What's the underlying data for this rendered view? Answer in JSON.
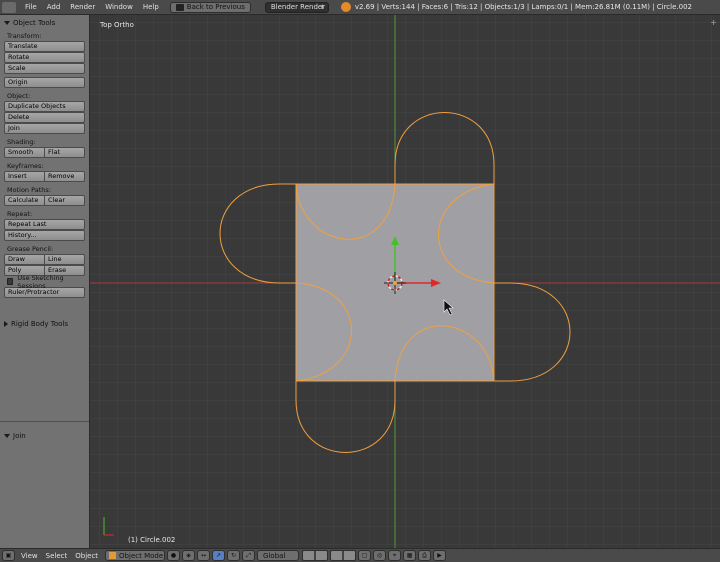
{
  "topbar": {
    "menu": [
      "File",
      "Add",
      "Render",
      "Window",
      "Help"
    ],
    "back_button": "Back to Previous",
    "render_engine": "Blender Render",
    "stats": "v2.69 | Verts:144 | Faces:6 | Tris:12 | Objects:1/3 | Lamps:0/1 | Mem:26.81M (0.11M) | Circle.002"
  },
  "toolshelf": {
    "title": "Object Tools",
    "transform_label": "Transform:",
    "translate": "Translate",
    "rotate": "Rotate",
    "scale": "Scale",
    "origin": "Origin",
    "object_label": "Object:",
    "duplicate": "Duplicate Objects",
    "delete": "Delete",
    "join": "Join",
    "shading_label": "Shading:",
    "smooth": "Smooth",
    "flat": "Flat",
    "keyframes_label": "Keyframes:",
    "insert": "Insert",
    "remove": "Remove",
    "motion_label": "Motion Paths:",
    "calculate": "Calculate",
    "clear": "Clear",
    "repeat_label": "Repeat:",
    "repeat_last": "Repeat Last",
    "history": "History...",
    "grease_label": "Grease Pencil:",
    "draw": "Draw",
    "line": "Line",
    "poly": "Poly",
    "erase": "Erase",
    "sketching": "Use Sketching Sessions",
    "ruler": "Ruler/Protractor",
    "rigid": "Rigid Body Tools",
    "redo_panel": "Join"
  },
  "viewport": {
    "view_name": "Top Ortho",
    "object_info": "(1) Circle.002",
    "colors": {
      "background": "#393939",
      "grid": "#454545",
      "x_axis": "#a53a3a",
      "y_axis": "#4f9a3a",
      "plane": "#a0a0a4",
      "outline": "#f0a040"
    }
  },
  "bottombar": {
    "menu": [
      "View",
      "Select",
      "Object"
    ],
    "mode": "Object Mode",
    "orientation": "Global"
  }
}
